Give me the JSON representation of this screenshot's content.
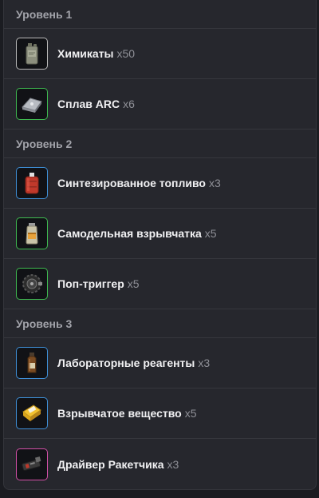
{
  "levels": [
    {
      "title": "Уровень 1",
      "items": [
        {
          "name": "Химикаты",
          "qty": "x50",
          "icon": "chemical-canister-icon",
          "rarity": "#b9b9b9"
        },
        {
          "name": "Сплав ARC",
          "qty": "x6",
          "icon": "alloy-ingot-icon",
          "rarity": "#3fb950"
        }
      ]
    },
    {
      "title": "Уровень 2",
      "items": [
        {
          "name": "Синтезированное топливо",
          "qty": "x3",
          "icon": "fuel-canister-icon",
          "rarity": "#3f8fd6"
        },
        {
          "name": "Самодельная взрывчатка",
          "qty": "x5",
          "icon": "explosive-jar-icon",
          "rarity": "#3fb950"
        },
        {
          "name": "Поп-триггер",
          "qty": "x5",
          "icon": "trigger-mechanism-icon",
          "rarity": "#3fb950"
        }
      ]
    },
    {
      "title": "Уровень 3",
      "items": [
        {
          "name": "Лабораторные реагенты",
          "qty": "x3",
          "icon": "reagent-bottle-icon",
          "rarity": "#3f8fd6"
        },
        {
          "name": "Взрывчатое вещество",
          "qty": "x5",
          "icon": "explosive-compound-icon",
          "rarity": "#3f8fd6"
        },
        {
          "name": "Драйвер Ракетчика",
          "qty": "x3",
          "icon": "rocket-driver-icon",
          "rarity": "#d24fa6"
        }
      ]
    }
  ]
}
